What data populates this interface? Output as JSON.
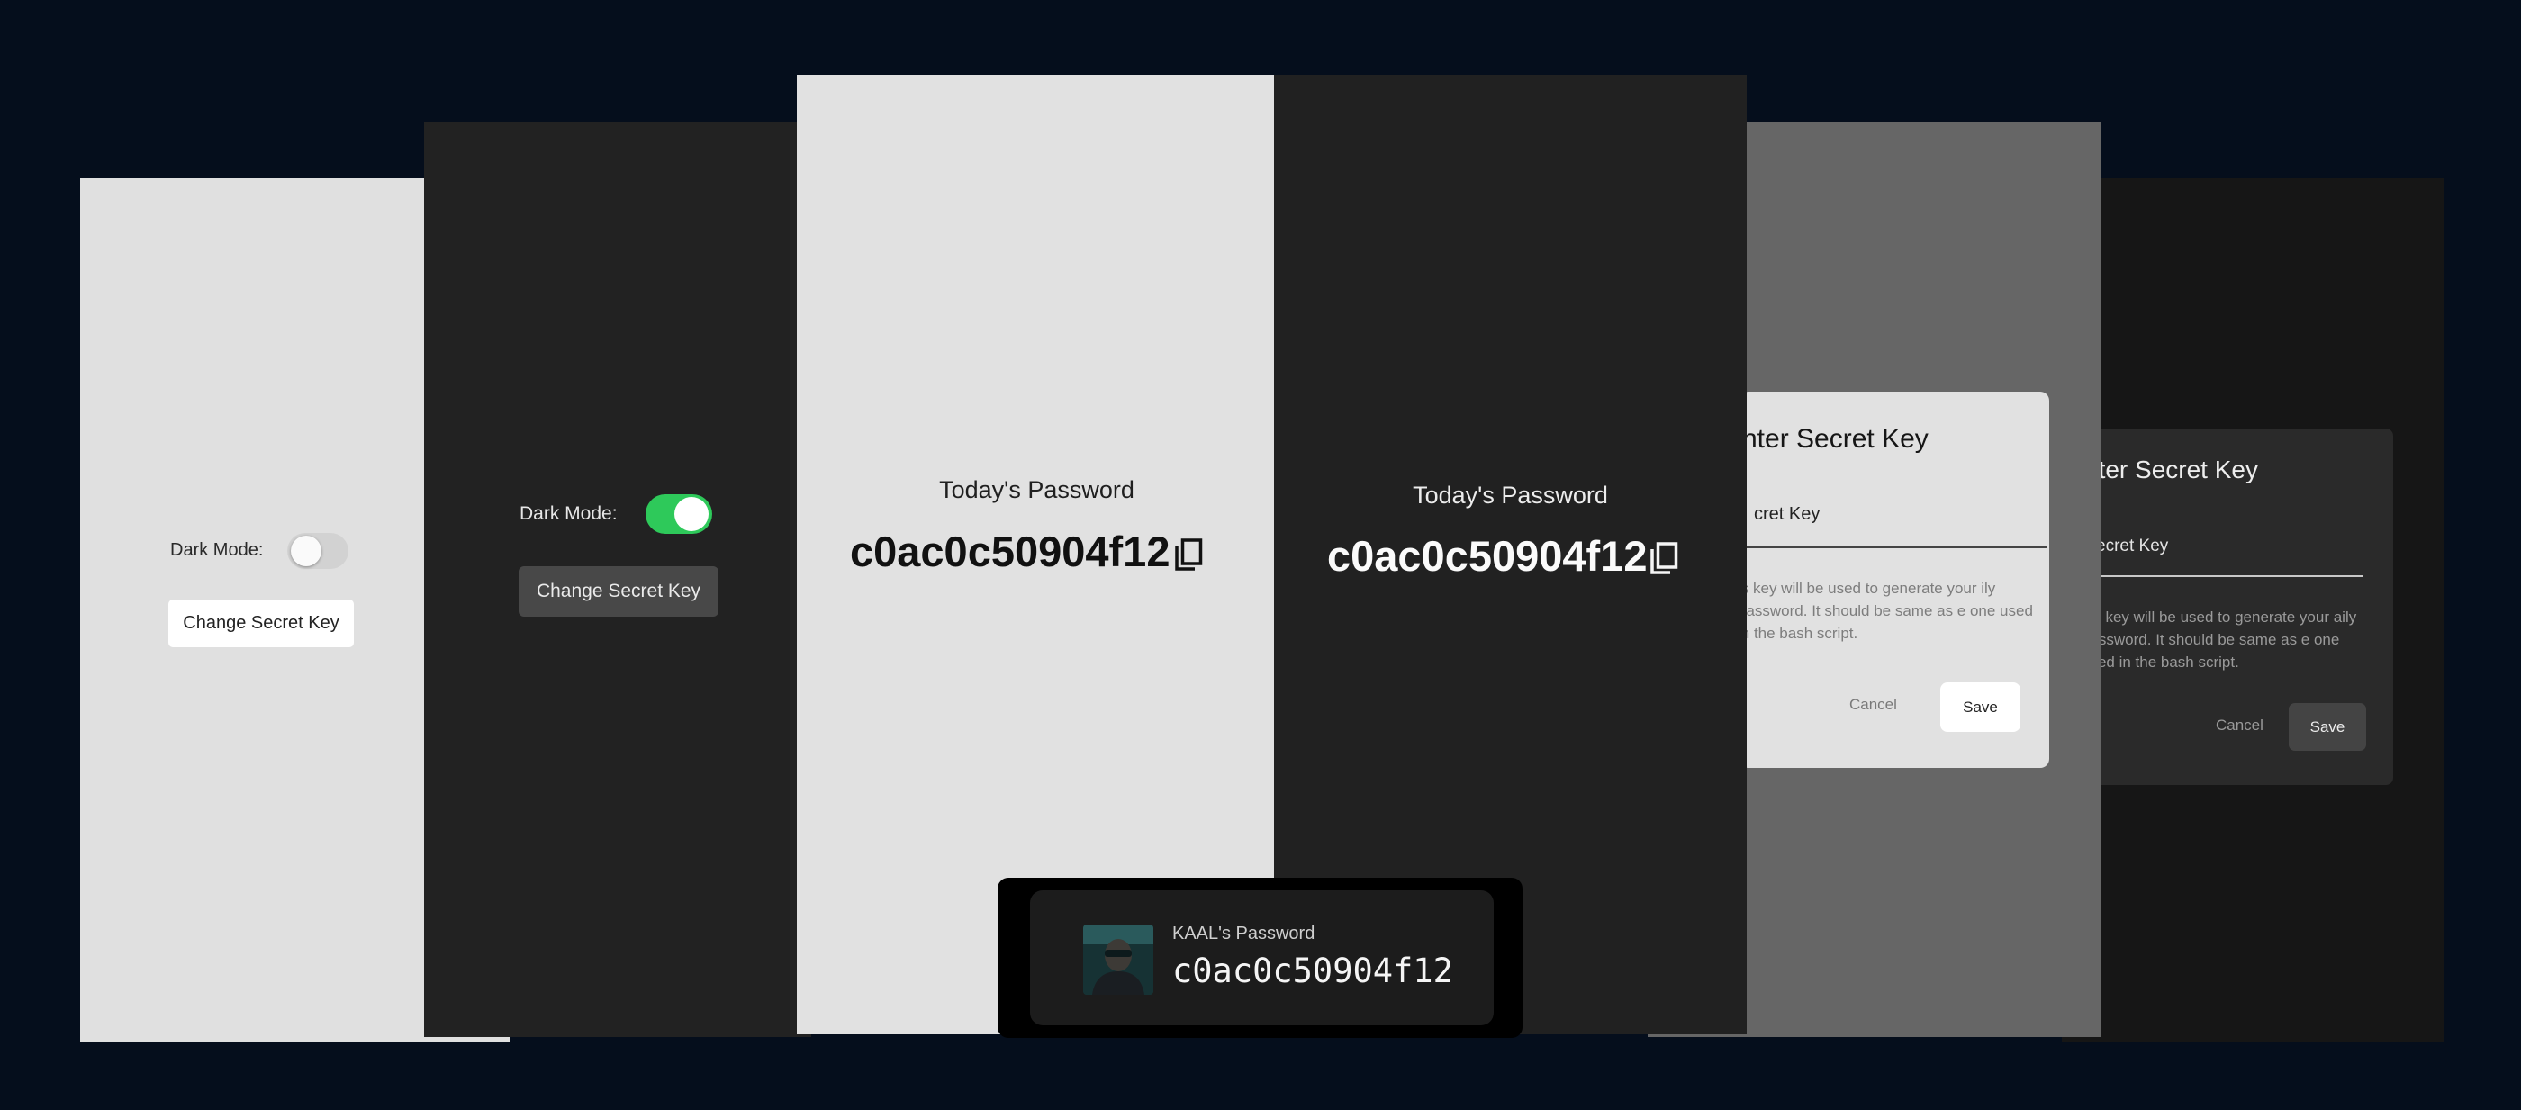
{
  "settings_light": {
    "dark_mode_label": "Dark Mode:",
    "dark_mode_on": false,
    "change_key_button": "Change Secret Key"
  },
  "settings_dark": {
    "dark_mode_label": "Dark Mode:",
    "dark_mode_on": true,
    "change_key_button": "Change Secret Key",
    "toggle_color": "#2ec95a"
  },
  "password_light": {
    "title": "Today's Password",
    "password": "c0ac0c50904f12",
    "copy_icon": "copy-icon"
  },
  "password_dark": {
    "title": "Today's Password",
    "password": "c0ac0c50904f12",
    "copy_icon": "copy-icon"
  },
  "dialog_light": {
    "title": "nter Secret Key",
    "field_label": "cret Key",
    "help_text": "is key will be used to generate your ily password. It should be same as e one used in the bash script.",
    "cancel_label": "Cancel",
    "save_label": "Save"
  },
  "dialog_dark": {
    "title": "nter Secret Key",
    "field_label": "ecret Key",
    "help_text": "his key will be used to generate your aily password. It should be same as e one used in the bash script.",
    "cancel_label": "Cancel",
    "save_label": "Save"
  },
  "notification": {
    "title": "KAAL's Password",
    "password": "c0ac0c50904f12",
    "avatar_icon": "avatar"
  },
  "colors": {
    "background": "#050e1c",
    "light_surface": "#e0e0e0",
    "dark_surface": "#222222",
    "accent_green": "#2ec95a"
  }
}
